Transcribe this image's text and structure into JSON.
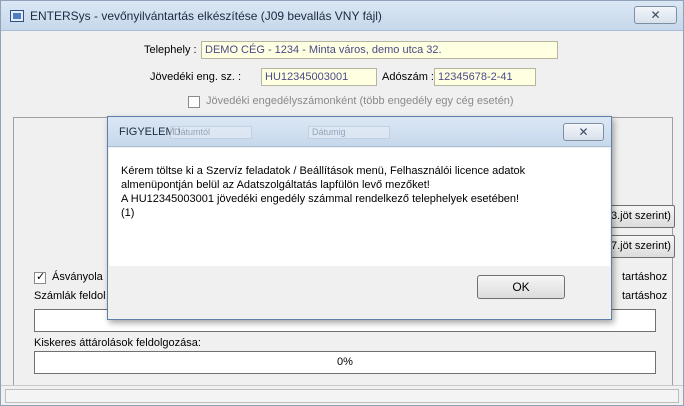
{
  "window": {
    "title": "ENTERSys - vevőnyilvántartás elkészítése (J09 bevallás VNY fájl)",
    "close_glyph": "✕"
  },
  "form": {
    "telephely_label": "Telephely :",
    "telephely_value": "DEMO CÉG - 1234 - Minta város, demo utca 32.",
    "jovedeki_label": "Jövedéki eng. sz. :",
    "jovedeki_value": "HU12345003001",
    "adoszam_label": "Adószám :",
    "adoszam_value": "12345678-2-41",
    "checkbox_label": "Jövedéki engedélyszámonként (több engedély egy cég esetén)"
  },
  "panel": {
    "btn1_label": "3.jöt szerint)",
    "btn2_label": "7.jöt szerint)",
    "asvanyolaj_label": "Ásványola",
    "right_text1": "tartáshoz",
    "szamlak_label": "Számlák feldol",
    "right_text2": "tartáshoz",
    "kiskeres_label": "Kiskeres áttárolások feldolgozása:",
    "progress_text": "0%"
  },
  "dialog": {
    "title": "FIGYELEM !",
    "ghost1": "Dátumtól",
    "ghost2": "Dátumig",
    "message": "Kérem töltse ki a Szervíz feladatok / Beállítások menü, Felhasználói licence adatok\nalmenüpontján belül az Adatszolgáltatás lapfülön levő mezőket!\nA HU12345003001 jövedéki engedély számmal rendelkező telephelyek esetében!\n(1)",
    "ok_label": "OK",
    "close_glyph": "✕"
  }
}
